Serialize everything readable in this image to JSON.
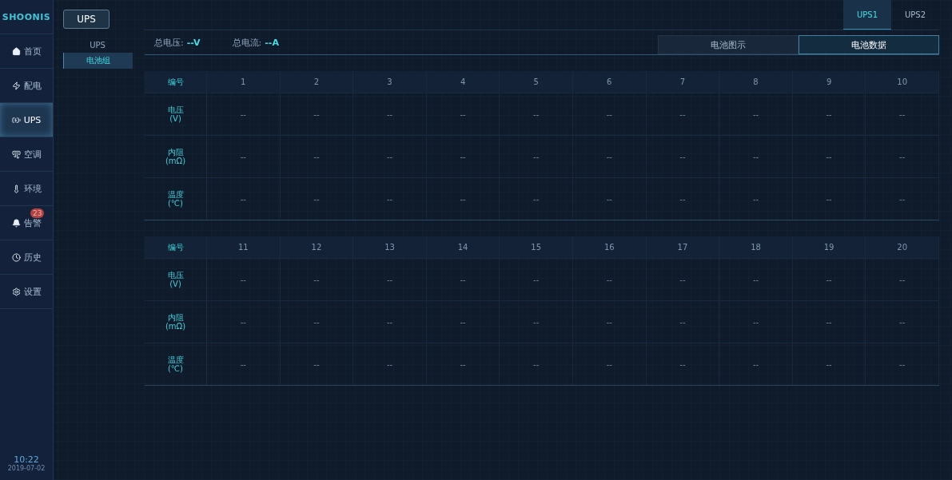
{
  "logo": "SHOONIS",
  "nav": [
    {
      "kind": "home",
      "label": "首页",
      "selected": false
    },
    {
      "kind": "power",
      "label": "配电",
      "selected": false
    },
    {
      "kind": "ups",
      "label": "UPS",
      "selected": true
    },
    {
      "kind": "ac",
      "label": "空调",
      "selected": false
    },
    {
      "kind": "env",
      "label": "环境",
      "selected": false
    },
    {
      "kind": "alarm",
      "label": "告警",
      "selected": false,
      "badge": "23"
    },
    {
      "kind": "history",
      "label": "历史",
      "selected": false
    },
    {
      "kind": "settings",
      "label": "设置",
      "selected": false
    }
  ],
  "clock": {
    "time": "10:22",
    "date": "2019-07-02"
  },
  "section_title": "UPS",
  "subnav": [
    {
      "label": "UPS",
      "selected": false
    },
    {
      "label": "电池组",
      "selected": true
    }
  ],
  "device_tabs": [
    {
      "label": "UPS1",
      "selected": true
    },
    {
      "label": "UPS2",
      "selected": false
    }
  ],
  "totals": [
    {
      "label": "总电压:",
      "value": "--V"
    },
    {
      "label": "总电流:",
      "value": "--A"
    }
  ],
  "view_tabs": [
    {
      "label": "电池图示",
      "selected": false
    },
    {
      "label": "电池数据",
      "selected": true
    }
  ],
  "tables": [
    {
      "header": "编号",
      "numbers": [
        "1",
        "2",
        "3",
        "4",
        "5",
        "6",
        "7",
        "8",
        "9",
        "10"
      ],
      "rows": [
        {
          "label": "电压",
          "unit": "(V)",
          "values": [
            "--",
            "--",
            "--",
            "--",
            "--",
            "--",
            "--",
            "--",
            "--",
            "--"
          ]
        },
        {
          "label": "内阻",
          "unit": "(mΩ)",
          "values": [
            "--",
            "--",
            "--",
            "--",
            "--",
            "--",
            "--",
            "--",
            "--",
            "--"
          ]
        },
        {
          "label": "温度",
          "unit": "(℃)",
          "values": [
            "--",
            "--",
            "--",
            "--",
            "--",
            "--",
            "--",
            "--",
            "--",
            "--"
          ]
        }
      ]
    },
    {
      "header": "编号",
      "numbers": [
        "11",
        "12",
        "13",
        "14",
        "15",
        "16",
        "17",
        "18",
        "19",
        "20"
      ],
      "rows": [
        {
          "label": "电压",
          "unit": "(V)",
          "values": [
            "--",
            "--",
            "--",
            "--",
            "--",
            "--",
            "--",
            "--",
            "--",
            "--"
          ]
        },
        {
          "label": "内阻",
          "unit": "(mΩ)",
          "values": [
            "--",
            "--",
            "--",
            "--",
            "--",
            "--",
            "--",
            "--",
            "--",
            "--"
          ]
        },
        {
          "label": "温度",
          "unit": "(℃)",
          "values": [
            "--",
            "--",
            "--",
            "--",
            "--",
            "--",
            "--",
            "--",
            "--",
            "--"
          ]
        }
      ]
    }
  ]
}
